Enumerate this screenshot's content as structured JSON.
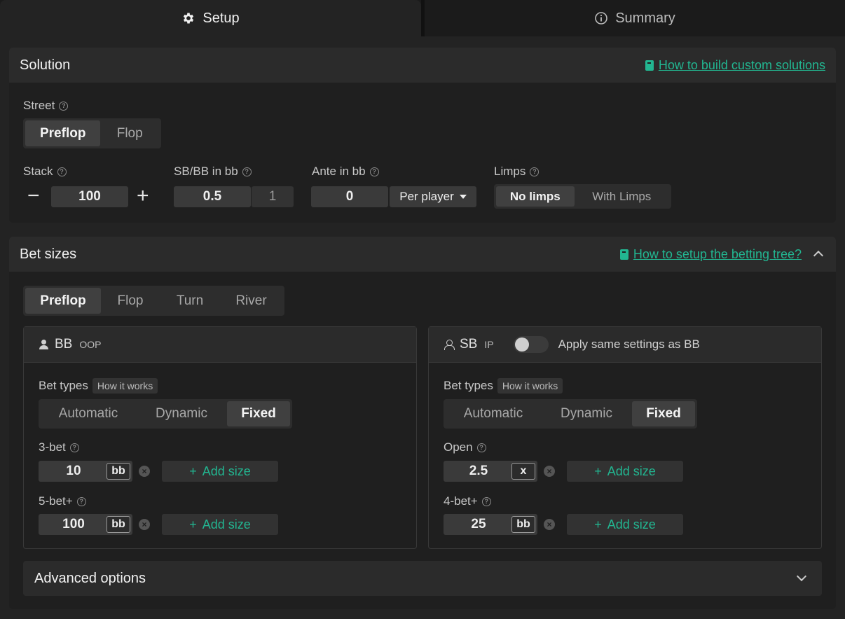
{
  "tabs": [
    {
      "label": "Setup",
      "icon": "gear-icon",
      "active": true
    },
    {
      "label": "Summary",
      "icon": "info-icon",
      "active": false
    }
  ],
  "solution": {
    "title": "Solution",
    "help_link": "How to build custom solutions",
    "street": {
      "label": "Street",
      "options": [
        "Preflop",
        "Flop"
      ],
      "selected": "Preflop"
    },
    "stack": {
      "label": "Stack",
      "value": "100",
      "minus": "−",
      "plus": "+"
    },
    "sbbb": {
      "label": "SB/BB in bb",
      "sb": "0.5",
      "bb": "1"
    },
    "ante": {
      "label": "Ante in bb",
      "value": "0",
      "mode": "Per player"
    },
    "limps": {
      "label": "Limps",
      "options": [
        "No limps",
        "With Limps"
      ],
      "selected": "No limps"
    }
  },
  "bet_sizes": {
    "title": "Bet sizes",
    "help_link": "How to setup the betting tree?",
    "streets": [
      "Preflop",
      "Flop",
      "Turn",
      "River"
    ],
    "selected_street": "Preflop",
    "players": [
      {
        "name": "BB",
        "position": "OOP",
        "bet_types_label": "Bet types",
        "how_it_works": "How it works",
        "bet_types": [
          "Automatic",
          "Dynamic",
          "Fixed"
        ],
        "selected": "Fixed",
        "rows": [
          {
            "label": "3-bet",
            "value": "10",
            "unit": "bb",
            "add": "Add size"
          },
          {
            "label": "5-bet+",
            "value": "100",
            "unit": "bb",
            "add": "Add size"
          }
        ]
      },
      {
        "name": "SB",
        "position": "IP",
        "apply_same": "Apply same settings as BB",
        "bet_types_label": "Bet types",
        "how_it_works": "How it works",
        "bet_types": [
          "Automatic",
          "Dynamic",
          "Fixed"
        ],
        "selected": "Fixed",
        "rows": [
          {
            "label": "Open",
            "value": "2.5",
            "unit": "x",
            "add": "Add size"
          },
          {
            "label": "4-bet+",
            "value": "25",
            "unit": "bb",
            "add": "Add size"
          }
        ]
      }
    ]
  },
  "advanced": {
    "title": "Advanced options"
  },
  "colors": {
    "accent": "#22b691",
    "bg": "#1b1b1b",
    "panel": "#2b2b2b"
  }
}
